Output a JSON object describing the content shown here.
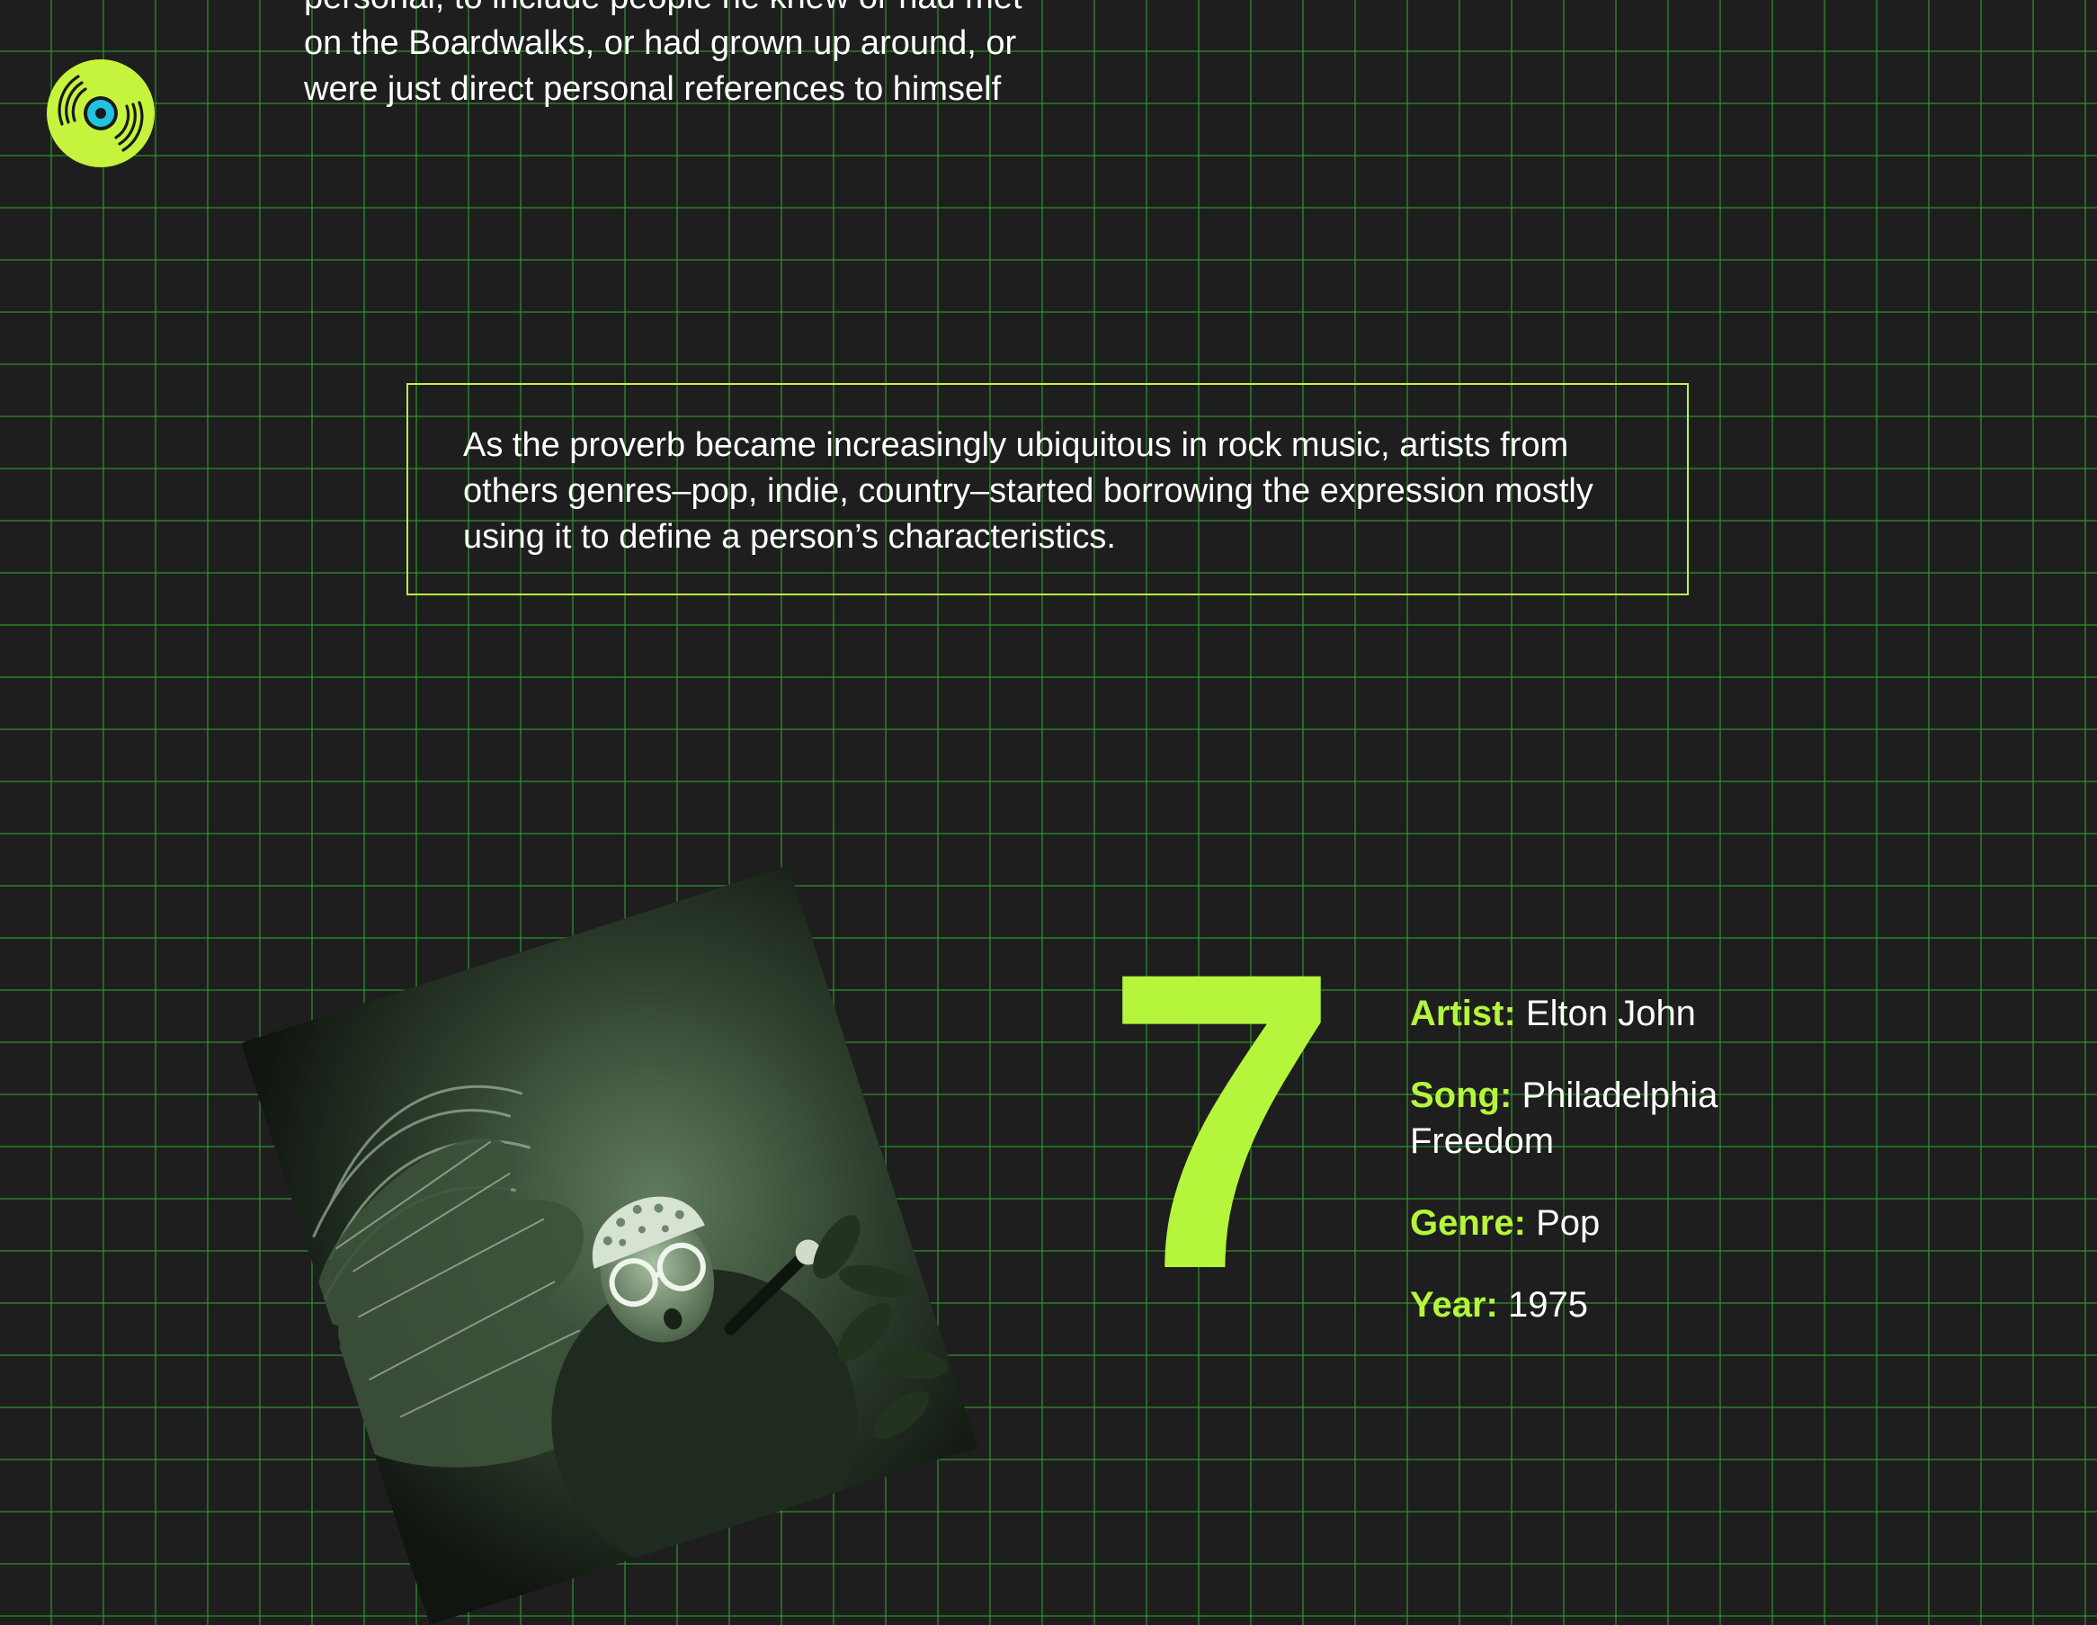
{
  "logo": {
    "icon": "vinyl-record-icon",
    "colors": {
      "disc": "#c6f43c",
      "grooves": "#1a1a1a",
      "label": "#21c3e0"
    }
  },
  "intro": {
    "paragraph": "personal, to include people he knew or had met on the Boardwalks, or had grown up around, or were just direct personal references to himself"
  },
  "quote": {
    "text": "As the proverb became increasingly ubiquitous in rock music, artists from others genres–pop, indie, country–started borrowing the expression mostly using it to define a person’s characteristics."
  },
  "entry": {
    "rank": "7",
    "facts": [
      {
        "label": "Artist:",
        "value": "Elton John"
      },
      {
        "label": "Song:",
        "value": "Philadelphia Freedom"
      },
      {
        "label": "Genre:",
        "value": "Pop"
      },
      {
        "label": "Year:",
        "value": "1975"
      }
    ]
  },
  "theme": {
    "background": "#1e1e1e",
    "grid": "#2ea028",
    "accent": "#b5f53b",
    "text": "#ffffff"
  }
}
